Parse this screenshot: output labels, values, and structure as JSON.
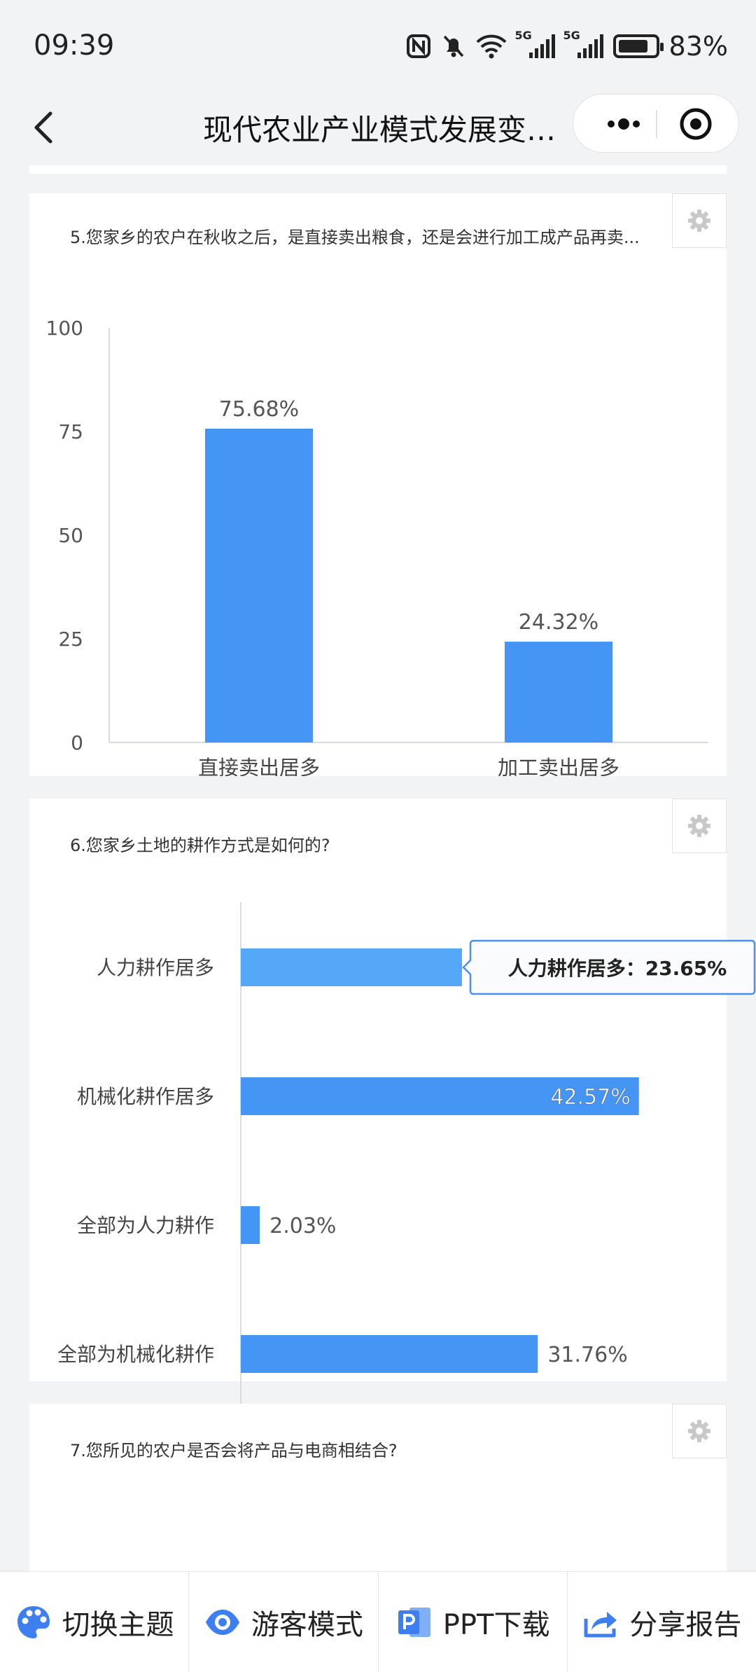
{
  "status_bar": {
    "time": "09:39",
    "network_1": "5G",
    "network_2": "5G",
    "battery": "83%"
  },
  "nav": {
    "title": "现代农业产业模式发展变…"
  },
  "cards": [
    {
      "question": "5.您家乡的农户在秋收之后，是直接卖出粮食，还是会进行加工成产品再卖...",
      "chart_type": "bar"
    },
    {
      "question": "6.您家乡土地的耕作方式是如何的?",
      "chart_type": "horizontal-bar",
      "tooltip": "人力耕作居多：23.65%"
    },
    {
      "question": "7.您所见的农户是否会将产品与电商相结合?"
    }
  ],
  "chart_data": [
    {
      "type": "bar",
      "categories": [
        "直接卖出居多",
        "加工卖出居多"
      ],
      "values": [
        75.68,
        24.32
      ],
      "data_labels": [
        "75.68%",
        "24.32%"
      ],
      "y_ticks": [
        "0",
        "25",
        "50",
        "75",
        "100"
      ],
      "ylim": [
        0,
        100
      ],
      "color": "#4595f5"
    },
    {
      "type": "bar",
      "orientation": "horizontal",
      "categories": [
        "人力耕作居多",
        "机械化耕作居多",
        "全部为人力耕作",
        "全部为机械化耕作"
      ],
      "values": [
        23.65,
        42.57,
        2.03,
        31.76
      ],
      "data_labels": [
        "23.65%",
        "42.57%",
        "2.03%",
        "31.76%"
      ],
      "x_ticks": [
        "0",
        "10",
        "20",
        "30",
        "40",
        "50"
      ],
      "xlim": [
        0,
        50
      ],
      "color": "#4595f5",
      "highlight_color": "#55a8f8"
    }
  ],
  "toolbar": {
    "theme": "切换主题",
    "guest": "游客模式",
    "ppt": "PPT下载",
    "share": "分享报告"
  },
  "colors": {
    "accent": "#3d7ff0",
    "bar": "#4595f5"
  }
}
